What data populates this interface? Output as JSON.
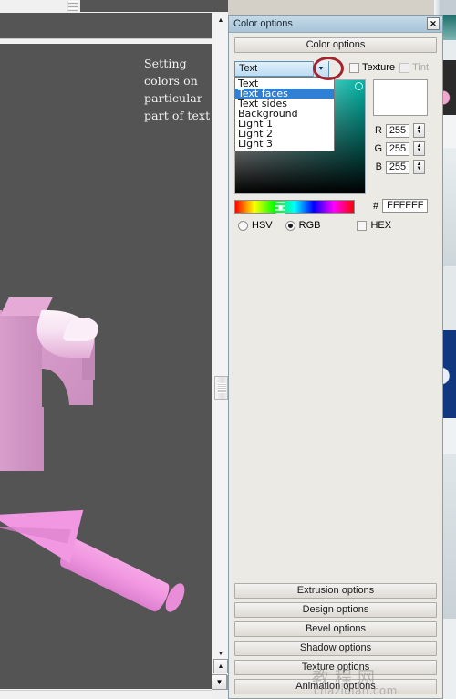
{
  "dialog": {
    "window_title": "Color options",
    "close_icon": "close-icon",
    "header_button": "Color options",
    "combo": {
      "value": "Text",
      "arrow_icon": "chevron-down-icon",
      "options": [
        "Text",
        "Text faces",
        "Text sides",
        "Background",
        "Light 1",
        "Light 2",
        "Light 3"
      ],
      "selected_option": "Text faces"
    },
    "checkboxes": [
      {
        "label": "Texture",
        "checked": false,
        "disabled": false
      },
      {
        "label": "Tint",
        "checked": false,
        "disabled": true
      }
    ],
    "swatch_color": "#FFFFFF",
    "channels": [
      {
        "name": "R",
        "value": "255"
      },
      {
        "name": "G",
        "value": "255"
      },
      {
        "name": "B",
        "value": "255"
      }
    ],
    "hex": {
      "prefix": "#",
      "value": "FFFFFF"
    },
    "color_modes": [
      {
        "label": "HSV",
        "selected": false
      },
      {
        "label": "RGB",
        "selected": true
      }
    ],
    "hex_toggle": {
      "label": "HEX",
      "checked": false
    },
    "section_buttons": [
      "Extrusion options",
      "Design options",
      "Bevel options",
      "Shadow options",
      "Texture options",
      "Animation options"
    ]
  },
  "viewport": {
    "annotation": "Setting colors on particular part of text",
    "scroll_up_icon": "triangle-up-icon",
    "scroll_down_icon": "triangle-down-icon",
    "scroll_first_icon": "scroll-top-icon",
    "scroll_last_icon": "scroll-bottom-icon",
    "scroll_right_icon": "triangle-right-icon",
    "model": {
      "letter": "r",
      "face_color": "#EFAADF",
      "side_color": "#CB8FBF",
      "highlight_color": "#FBEEF8",
      "arrow_color": "#F298E2",
      "background_color": "#555455"
    }
  },
  "watermark": {
    "cjk": "教程网",
    "domain": "chazidian.com"
  }
}
